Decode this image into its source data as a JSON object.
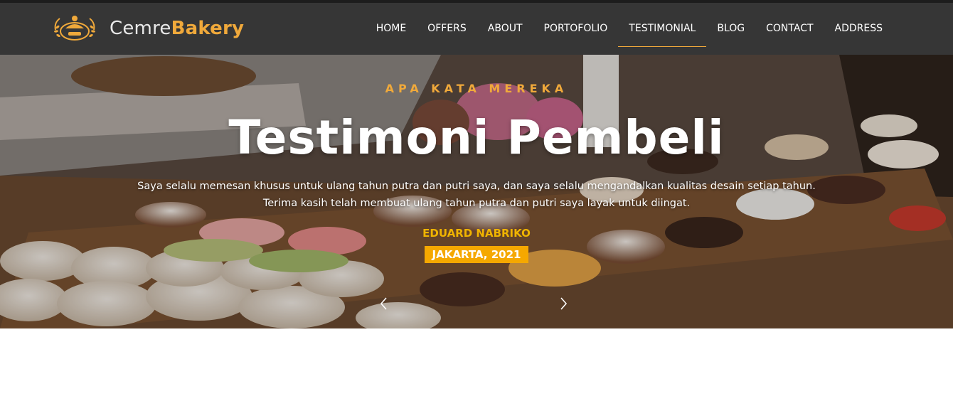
{
  "brand": {
    "name_light": "Cemre",
    "name_bold": "Bakery"
  },
  "nav": {
    "items": [
      {
        "label": "HOME"
      },
      {
        "label": "OFFERS"
      },
      {
        "label": "ABOUT"
      },
      {
        "label": "PORTOFOLIO"
      },
      {
        "label": "TESTIMONIAL",
        "active": true
      },
      {
        "label": "BLOG"
      },
      {
        "label": "CONTACT"
      },
      {
        "label": "ADDRESS"
      }
    ]
  },
  "testimonial": {
    "eyebrow": "APA KATA MEREKA",
    "title": "Testimoni Pembeli",
    "quote_line1": "Saya selalu memesan khusus untuk ulang tahun putra dan putri saya, dan saya selalu mengandalkan kualitas desain setiap tahun.",
    "quote_line2": "Terima kasih telah membuat ulang tahun putra dan putri saya layak untuk diingat.",
    "author": "EDUARD NABRIKO",
    "location": "JAKARTA, 2021"
  },
  "carousel": {
    "prev_icon": "chevron-left-icon",
    "next_icon": "chevron-right-icon"
  },
  "colors": {
    "navbar": "#363636",
    "accent": "#f0a93b",
    "badge": "#f5a800",
    "text": "#ffffff"
  }
}
